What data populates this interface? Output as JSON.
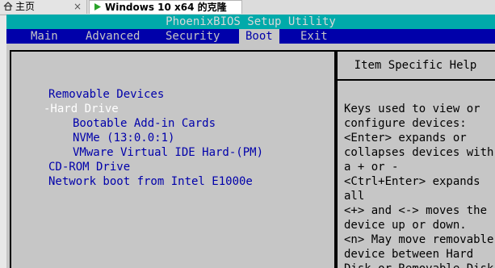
{
  "host_tabs": {
    "home_label": "主页",
    "vm_label": "Windows 10 x64 的克隆",
    "close_glyph": "×"
  },
  "bios": {
    "title": "PhoenixBIOS Setup Utility",
    "menu": [
      {
        "label": "Main"
      },
      {
        "label": "Advanced"
      },
      {
        "label": "Security"
      },
      {
        "label": "Boot"
      },
      {
        "label": "Exit"
      }
    ],
    "active_menu": "Boot",
    "boot_items": [
      {
        "text": "Removable Devices"
      },
      {
        "text": "-Hard Drive"
      },
      {
        "text": "Bootable Add-in Cards"
      },
      {
        "text": "NVMe (13:0.0:1)"
      },
      {
        "text": "VMware Virtual IDE Hard-(PM)"
      },
      {
        "text": "CD-ROM Drive"
      },
      {
        "text": "Network boot from Intel E1000e"
      }
    ],
    "selected_item": "-Hard Drive",
    "help": {
      "header": "Item Specific Help",
      "lines": [
        "Keys used to view or",
        "configure devices:",
        "<Enter> expands or",
        "collapses devices with",
        "a + or -",
        "<Ctrl+Enter> expands",
        "all",
        "<+> and <-> moves the",
        "device up or down.",
        "<n> May move removable",
        "device between Hard",
        "Disk or Removable Disk"
      ]
    },
    "colors": {
      "title_bar": "#00aaaa",
      "menu_bar": "#0000aa",
      "background": "#c6c6c6",
      "item_text": "#0000aa",
      "selected_text": "#ffffff"
    }
  }
}
